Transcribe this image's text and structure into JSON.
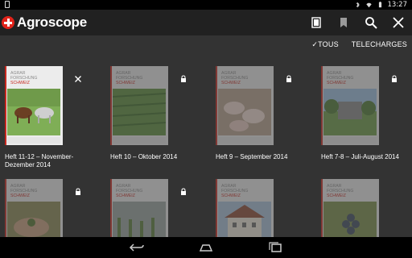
{
  "status_bar": {
    "time": "13:27"
  },
  "app": {
    "brand": "Agroscope",
    "accent_color": "#e2231a"
  },
  "actions": [
    {
      "name": "document-icon"
    },
    {
      "name": "bookmark-icon"
    },
    {
      "name": "search-icon"
    },
    {
      "name": "close-icon"
    }
  ],
  "tabs": {
    "all_label": "✓TOUS",
    "downloads_label": "TELECHARGES"
  },
  "cover_text": {
    "line1": "AGRAR",
    "line2": "FORSCHUNG",
    "line3": "SCHWEIZ"
  },
  "issues": [
    {
      "caption": "Heft 11-12 – November-Dezember 2014",
      "status": "downloaded",
      "badge": "close-icon",
      "photo": "cows"
    },
    {
      "caption": "Heft 10 – Oktober 2014",
      "status": "locked",
      "badge": "lock-icon",
      "photo": "field"
    },
    {
      "caption": "Heft 9 – September 2014",
      "status": "locked",
      "badge": "lock-icon",
      "photo": "pigs"
    },
    {
      "caption": "Heft 7-8 – Juli-August 2014",
      "status": "locked",
      "badge": "lock-icon",
      "photo": "orchard"
    },
    {
      "caption": "",
      "status": "locked",
      "badge": "lock-icon",
      "photo": "hands"
    },
    {
      "caption": "",
      "status": "locked",
      "badge": "lock-icon",
      "photo": "vineyard"
    },
    {
      "caption": "",
      "status": "locked",
      "badge": "none",
      "photo": "building"
    },
    {
      "caption": "",
      "status": "locked",
      "badge": "none",
      "photo": "grapes"
    }
  ],
  "nav": [
    {
      "name": "back-icon"
    },
    {
      "name": "home-icon"
    },
    {
      "name": "recents-icon"
    }
  ]
}
